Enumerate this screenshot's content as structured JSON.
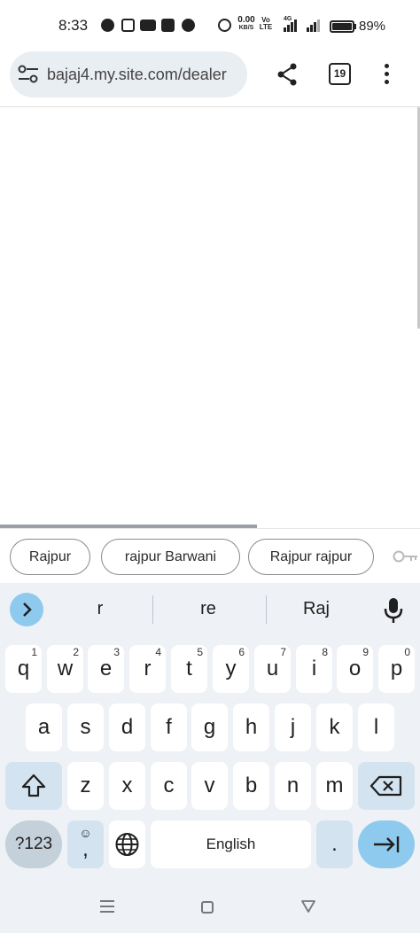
{
  "status_bar": {
    "time": "8:33",
    "net_speed_value": "0.00",
    "net_speed_unit": "KB/S",
    "volte_label": "Vo LTE",
    "network_type": "4G",
    "battery_percent": "89%",
    "app_icons": [
      "whatsapp-icon",
      "instagram-icon",
      "youtube-icon",
      "music-icon",
      "chrome-icon"
    ]
  },
  "browser": {
    "url": "bajaj4.my.site.com/dealer",
    "tab_count": "19"
  },
  "autofill": {
    "chips": [
      "Rajpur",
      "rajpur Barwani",
      "Rajpur rajpur"
    ]
  },
  "keyboard": {
    "suggestions": [
      "r",
      "re",
      "Raj"
    ],
    "rows": [
      [
        {
          "label": "q",
          "hint": "1"
        },
        {
          "label": "w",
          "hint": "2"
        },
        {
          "label": "e",
          "hint": "3"
        },
        {
          "label": "r",
          "hint": "4"
        },
        {
          "label": "t",
          "hint": "5"
        },
        {
          "label": "y",
          "hint": "6"
        },
        {
          "label": "u",
          "hint": "7"
        },
        {
          "label": "i",
          "hint": "8"
        },
        {
          "label": "o",
          "hint": "9"
        },
        {
          "label": "p",
          "hint": "0"
        }
      ],
      [
        "a",
        "s",
        "d",
        "f",
        "g",
        "h",
        "j",
        "k",
        "l"
      ],
      [
        "z",
        "x",
        "c",
        "v",
        "b",
        "n",
        "m"
      ]
    ],
    "symbols_label": "?123",
    "emoji_comma_label": ",",
    "space_label": "English",
    "period_label": "."
  },
  "colors": {
    "accent": "#8ec9ee",
    "keyboard_bg": "#eef1f5",
    "function_key": "#d3e3ef"
  }
}
